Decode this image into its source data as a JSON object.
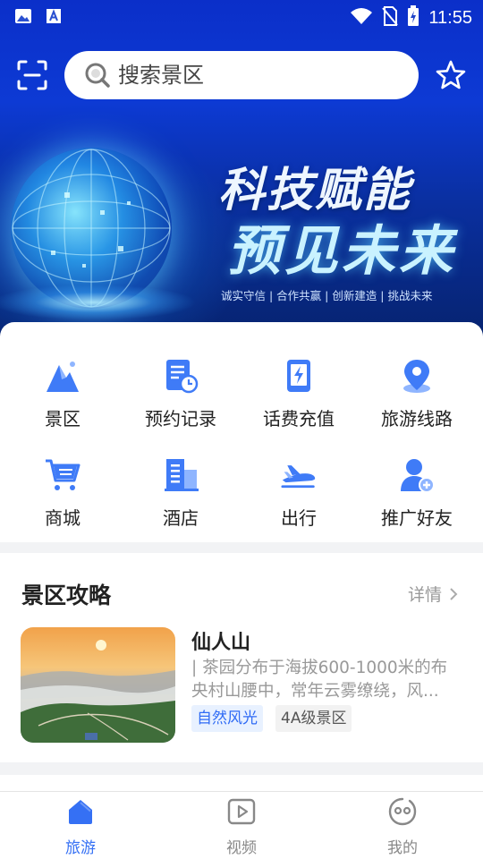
{
  "status_bar": {
    "time": "11:55"
  },
  "header": {
    "search_placeholder": "搜索景区",
    "icons": {
      "scan": "scan-icon",
      "search": "search-icon",
      "favorite": "star-icon"
    }
  },
  "banner": {
    "line1": "科技赋能",
    "line2": "预见未来",
    "subtitle": "诚实守信 | 合作共赢 | 创新建造 | 挑战未来"
  },
  "menu": [
    {
      "label": "景区",
      "icon": "mountain-icon"
    },
    {
      "label": "预约记录",
      "icon": "booking-record-icon"
    },
    {
      "label": "话费充值",
      "icon": "phone-recharge-icon"
    },
    {
      "label": "旅游线路",
      "icon": "location-pin-icon"
    },
    {
      "label": "商城",
      "icon": "shopping-cart-icon"
    },
    {
      "label": "酒店",
      "icon": "hotel-icon"
    },
    {
      "label": "出行",
      "icon": "plane-icon"
    },
    {
      "label": "推广好友",
      "icon": "add-friend-icon"
    }
  ],
  "guide": {
    "title": "景区攻略",
    "more_label": "详情",
    "card": {
      "name": "仙人山",
      "description": "| 茶园分布于海拔600-1000米的布央村山腰中，常年云雾缭绕，风...",
      "tags": [
        "自然风光",
        "4A级景区"
      ]
    }
  },
  "tabbar": {
    "tabs": [
      {
        "label": "旅游",
        "icon": "home-icon",
        "active": true
      },
      {
        "label": "视频",
        "icon": "video-play-icon",
        "active": false
      },
      {
        "label": "我的",
        "icon": "profile-face-icon",
        "active": false
      }
    ]
  },
  "colors": {
    "accent": "#3570f4",
    "icon_blue": "#3f7bf7",
    "banner_blue": "#0d3ad4"
  }
}
